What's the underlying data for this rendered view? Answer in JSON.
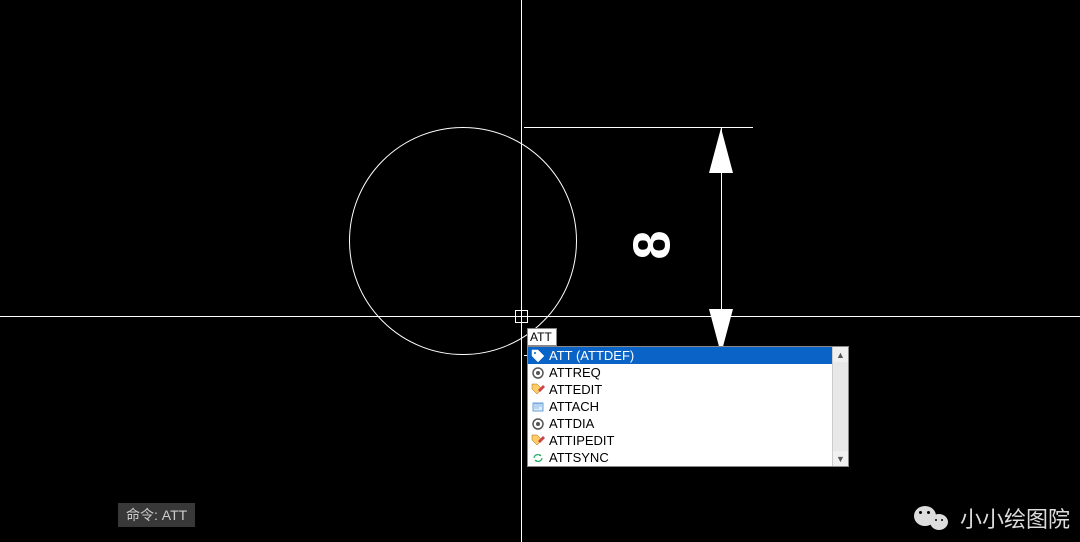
{
  "dimension": {
    "value": "8"
  },
  "input": {
    "text": "ATT"
  },
  "autocomplete": {
    "items": [
      {
        "label": "ATT (ATTDEF)",
        "icon": "tag-icon",
        "selected": true
      },
      {
        "label": "ATTREQ",
        "icon": "gear-icon",
        "selected": false
      },
      {
        "label": "ATTEDIT",
        "icon": "edit-tag-icon",
        "selected": false
      },
      {
        "label": "ATTACH",
        "icon": "attach-icon",
        "selected": false
      },
      {
        "label": "ATTDIA",
        "icon": "gear-icon",
        "selected": false
      },
      {
        "label": "ATTIPEDIT",
        "icon": "edit-tag-icon",
        "selected": false
      },
      {
        "label": "ATTSYNC",
        "icon": "sync-icon",
        "selected": false
      }
    ]
  },
  "commandline": {
    "prompt": "命令:",
    "value": "ATT"
  },
  "watermark": {
    "text": "小小绘图院"
  }
}
